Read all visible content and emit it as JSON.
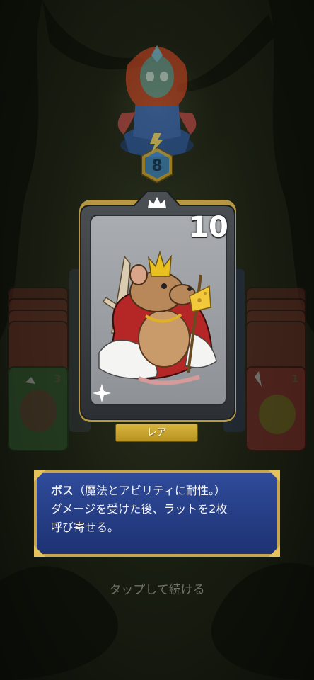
{
  "card": {
    "cost": "10",
    "rarity": "レア",
    "creature_icon": "rat-king-icon",
    "frame_icon": "crown-icon",
    "corner_icon": "sparkle-icon"
  },
  "description": {
    "keyword": "ボス",
    "line1_rest": "（魔法とアビリティに耐性。）",
    "line2": "ダメージを受けた後、ラットを2枚",
    "line3": "呼び寄せる。"
  },
  "prompt": "タップして続ける",
  "hero": {
    "level": "8",
    "level_icon": "lightning-icon"
  },
  "side_cards": {
    "left_count": "3",
    "right_count": "1"
  },
  "colors": {
    "rarity_gold": "#c9a62e",
    "desc_blue": "#263e86",
    "frame_gold": "#c8a548"
  }
}
